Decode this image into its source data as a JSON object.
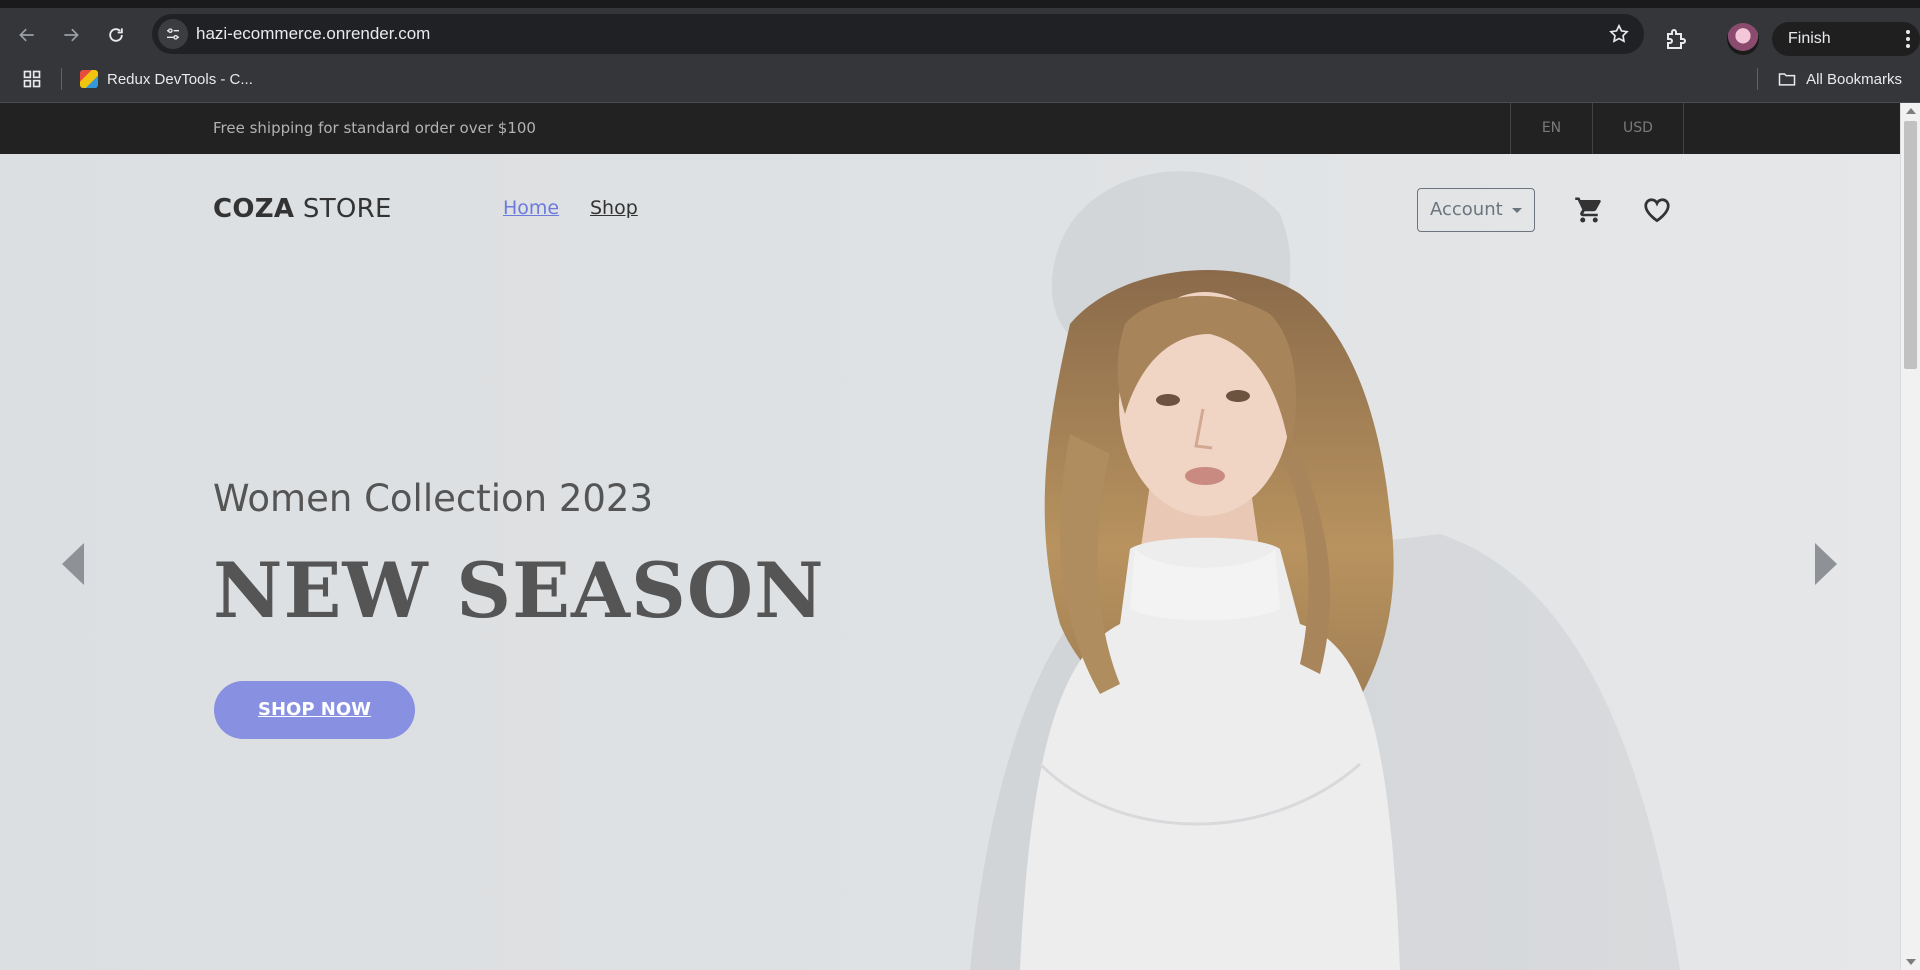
{
  "browser": {
    "url": "hazi-ecommerce.onrender.com",
    "finish_update_label": "Finish update",
    "bookmarks": [
      {
        "label": "Redux DevTools - C..."
      }
    ],
    "all_bookmarks_label": "All Bookmarks",
    "icons": {
      "back": "arrow-left-icon",
      "forward": "arrow-right-icon",
      "reload": "reload-icon",
      "site_info": "tune-icon",
      "star": "star-icon",
      "extensions": "puzzle-icon",
      "apps": "grid-icon",
      "folder": "folder-icon"
    }
  },
  "site": {
    "topbar": {
      "shipping_text": "Free shipping for standard order over $100",
      "language": "EN",
      "currency": "USD"
    },
    "header": {
      "logo_bold": "COZA",
      "logo_light": " STORE",
      "nav": [
        {
          "label": "Home",
          "active": true
        },
        {
          "label": "Shop",
          "active": false
        }
      ],
      "account_label": "Account"
    },
    "hero": {
      "subtitle": "Women Collection 2023",
      "title": "NEW SEASON",
      "cta_label": "SHOP NOW"
    },
    "colors": {
      "accent": "#6c7ae0",
      "cta_bg": "#8890e2",
      "topbar_bg": "#222222",
      "hero_bg": "#dde0e2",
      "text_dark": "#555555"
    }
  }
}
